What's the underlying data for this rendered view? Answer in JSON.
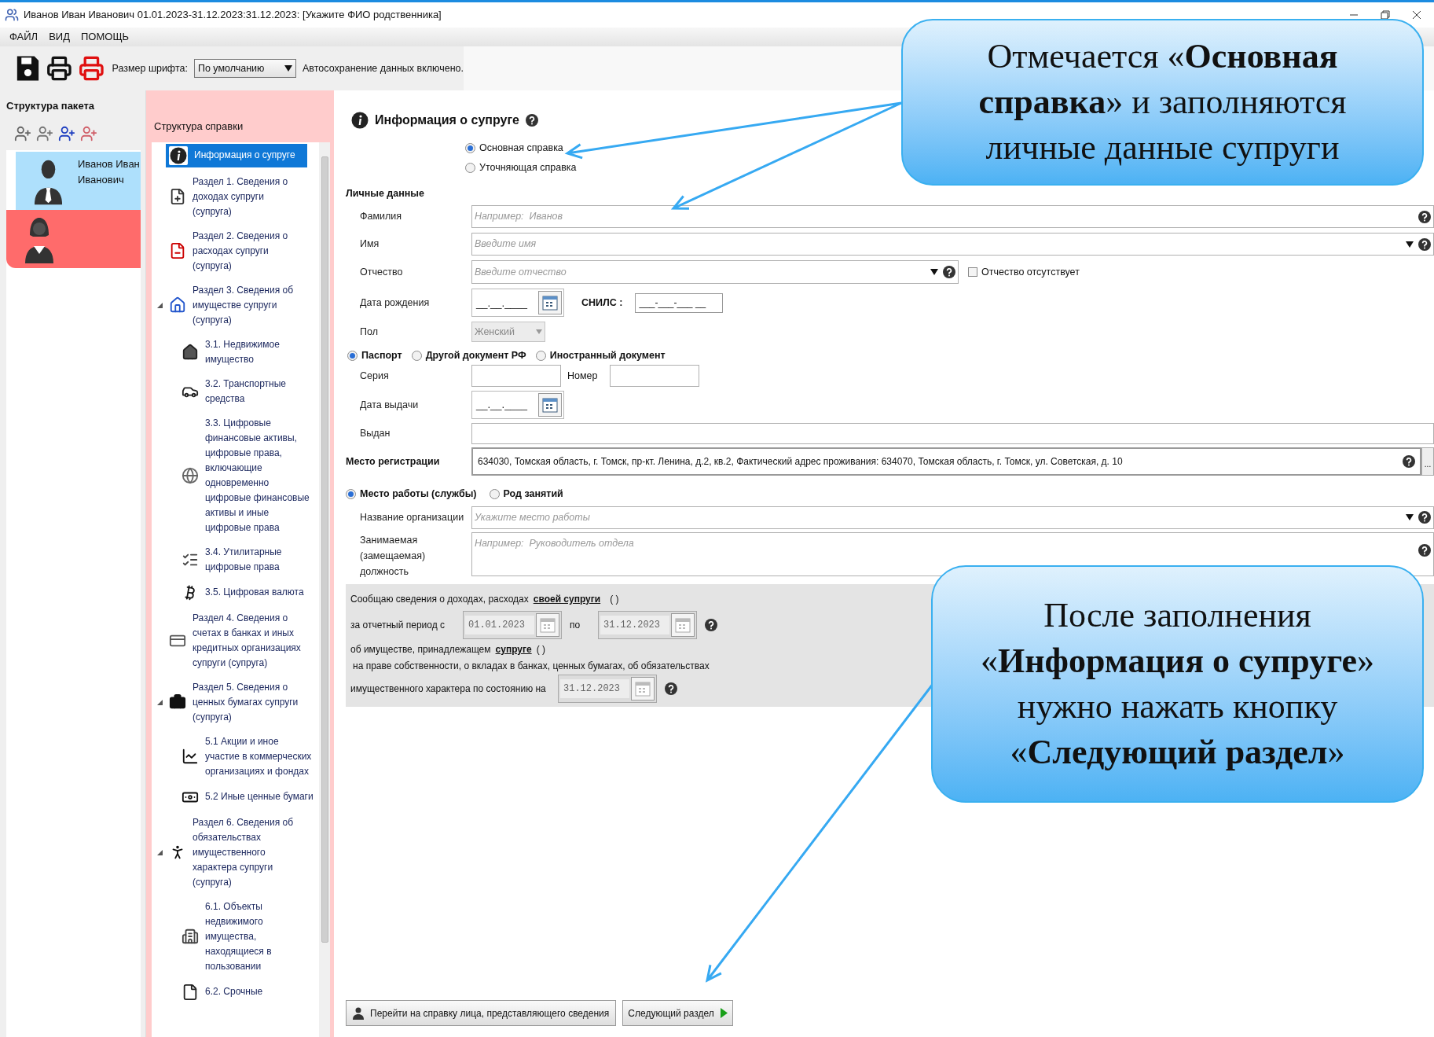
{
  "window": {
    "title": "Иванов Иван Иванович 01.01.2023-31.12.2023:31.12.2023: [Укажите ФИО родственника]"
  },
  "menu": [
    "ФАЙЛ",
    "ВИД",
    "ПОМОЩЬ"
  ],
  "toolbar": {
    "font_size_label": "Размер шрифта:",
    "font_size_value": "По умолчанию",
    "autosave_note": "Автосохранение данных включено."
  },
  "package_panel": {
    "title": "Структура пакета",
    "persons": [
      {
        "name": "Иванов Иван Иванович",
        "kind": "male",
        "color": "#aee0fc"
      },
      {
        "kind": "female",
        "color": "#ff6b6b"
      }
    ]
  },
  "tree": {
    "title": "Структура справки",
    "items": [
      {
        "label": "Информация о супруге",
        "kind": "info",
        "selected": true,
        "expanded": false
      },
      {
        "label": "Раздел 1. Сведения о доходах супруги (супруга)",
        "kind": "income",
        "selected": false,
        "expanded": false
      },
      {
        "label": "Раздел 2. Сведения о расходах супруги (супруга)",
        "kind": "expense",
        "selected": false,
        "expanded": false
      },
      {
        "label": "Раздел 3. Сведения об имуществе супруги (супруга)",
        "kind": "property",
        "selected": false,
        "expanded": true,
        "children": [
          {
            "label": "3.1. Недвижимое имущество",
            "kind": "house",
            "selected": false
          },
          {
            "label": "3.2. Транспортные средства",
            "kind": "car",
            "selected": false
          },
          {
            "label": "3.3. Цифровые финансовые активы, цифровые права, включающие одновременно цифровые финансовые активы и иные цифровые права",
            "kind": "digital",
            "selected": false
          },
          {
            "label": "3.4. Утилитарные цифровые права",
            "kind": "utility",
            "selected": false
          },
          {
            "label": "3.5. Цифровая валюта",
            "kind": "bitcoin",
            "selected": false
          }
        ]
      },
      {
        "label": "Раздел 4. Сведения о счетах в банках и иных кредитных организациях супруги (супруга)",
        "kind": "bank",
        "selected": false,
        "expanded": false
      },
      {
        "label": "Раздел 5. Сведения о ценных бумагах супруги (супруга)",
        "kind": "bag",
        "selected": false,
        "expanded": true,
        "children": [
          {
            "label": "5.1 Акции и иное участие в коммерческих организациях и фондах",
            "kind": "stocks",
            "selected": false
          },
          {
            "label": "5.2 Иные ценные бумаги",
            "kind": "securities",
            "selected": false
          }
        ]
      },
      {
        "label": "Раздел 6. Сведения об обязательствах имущественного характера супруги (супруга)",
        "kind": "debt",
        "selected": false,
        "expanded": true,
        "children": [
          {
            "label": "6.1. Объекты недвижимого имущества, находящиеся в пользовании",
            "kind": "building",
            "selected": false
          },
          {
            "label": "6.2. Срочные",
            "kind": "document",
            "selected": false
          }
        ]
      }
    ]
  },
  "form": {
    "title": "Информация о супруге",
    "report_type": [
      {
        "label": "Основная справка",
        "selected": true
      },
      {
        "label": "Уточняющая справка",
        "selected": false
      }
    ],
    "personal_title": "Личные данные",
    "surname": {
      "label": "Фамилия",
      "placeholder": "Например:  Иванов"
    },
    "name": {
      "label": "Имя",
      "placeholder": "Введите имя"
    },
    "patronymic": {
      "label": "Отчество",
      "placeholder": "Введите отчество",
      "no_patronymic": {
        "label": "Отчество отсутствует",
        "checked": false
      }
    },
    "birth_date": {
      "label": "Дата рождения",
      "mask": "__.__.____"
    },
    "snils": {
      "label": "СНИЛС :",
      "mask": "___-___-___ __"
    },
    "gender": {
      "label": "Пол",
      "value": "Женский",
      "disabled": true
    },
    "document_type": [
      {
        "label": "Паспорт",
        "selected": true
      },
      {
        "label": "Другой документ РФ",
        "selected": false
      },
      {
        "label": "Иностранный документ",
        "selected": false
      }
    ],
    "series": {
      "label": "Серия"
    },
    "number": {
      "label": "Номер"
    },
    "issue_date": {
      "label": "Дата выдачи",
      "mask": "__.__.____"
    },
    "issued_by": {
      "label": "Выдан"
    },
    "registration": {
      "label": "Место регистрации",
      "value": "634030, Томская область, г. Томск, пр-кт. Ленина, д.2, кв.2, Фактический адрес проживания: 634070, Томская область, г. Томск, ул. Советская, д. 10",
      "more_button": "..."
    },
    "work_type": [
      {
        "label": "Место работы (службы)",
        "selected": true
      },
      {
        "label": "Род занятий",
        "selected": false
      }
    ],
    "organization": {
      "label": "Название организации",
      "placeholder": "Укажите место работы"
    },
    "position": {
      "label": "Занимаемая (замещаемая) должность",
      "placeholder": "Например:  Руководитель отдела"
    },
    "statement": {
      "line1": "Сообщаю сведения о доходах, расходах",
      "link1": "своей супруги",
      "brackets1": "( )",
      "period_label": "за отчетный период с",
      "period_from": "01.01.2023",
      "period_to_label": "по",
      "period_to": "31.12.2023",
      "line2": "об имуществе, принадлежащем",
      "link2": "супруге",
      "brackets2": "( )",
      "line3": "на праве собственности, о вкладах в банках, ценных бумагах, об обязательствах",
      "line4": "имущественного характера по состоянию на",
      "state_date": "31.12.2023"
    },
    "buttons": {
      "go_to_declarant": "Перейти на справку лица, представляющего сведения",
      "next_section": "Следующий раздел"
    }
  },
  "callouts": [
    "Отмечается «**Основная справка**» и заполняются личные данные супруги",
    "После заполнения «**Информация о супруге**» нужно нажать кнопку «**Следующий раздел**»"
  ]
}
